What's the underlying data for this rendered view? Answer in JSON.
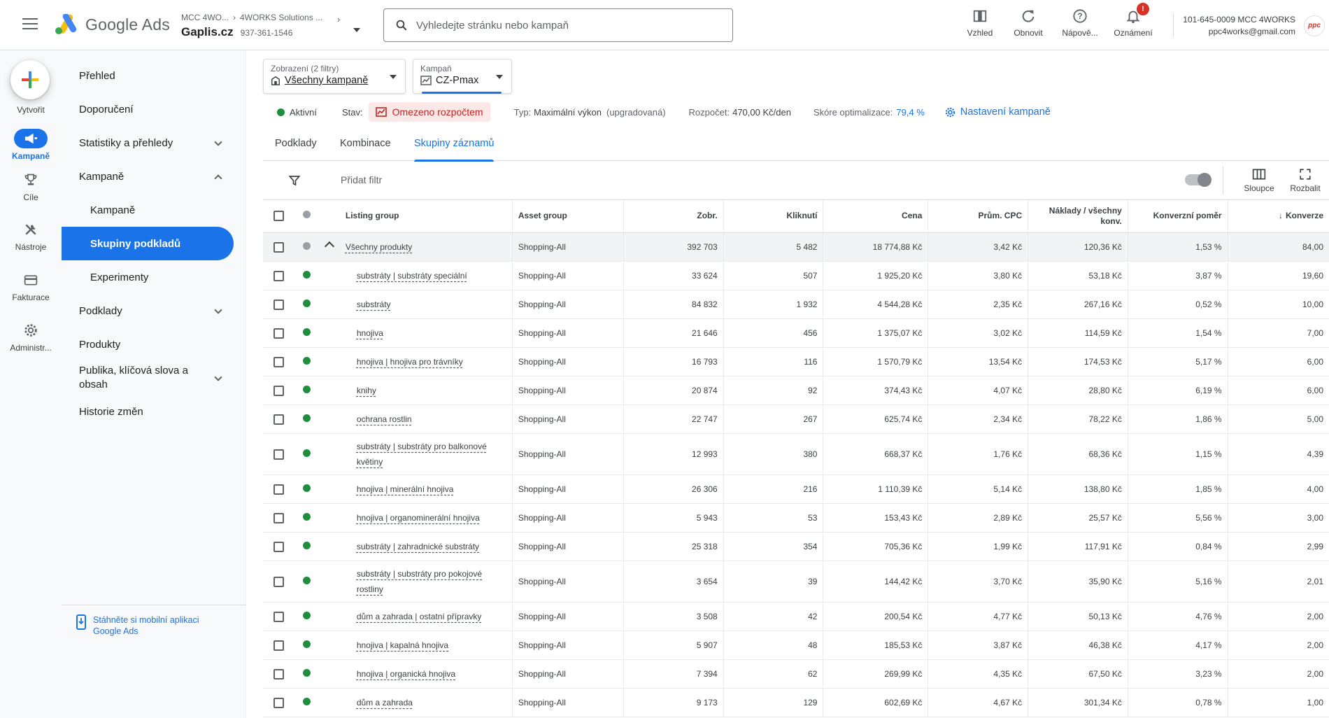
{
  "header": {
    "app_name": "Google Ads",
    "breadcrumb_manager": "MCC 4WO...",
    "breadcrumb_client": "4WORKS Solutions ...",
    "account_name": "Gaplis.cz",
    "account_id": "937-361-1546",
    "search_placeholder": "Vyhledejte stránku nebo kampaň",
    "actions": [
      {
        "label": "Vzhled",
        "icon": "appearance-icon"
      },
      {
        "label": "Obnovit",
        "icon": "refresh-icon"
      },
      {
        "label": "Nápově...",
        "icon": "help-icon"
      },
      {
        "label": "Oznámení",
        "icon": "notifications-icon",
        "badge": "!"
      }
    ],
    "user_line1": "101-645-0009 MCC 4WORKS",
    "user_line2": "ppc4works@gmail.com",
    "avatar_text": "ppc"
  },
  "rail": {
    "create_label": "Vytvořit",
    "items": [
      {
        "label": "Kampaně",
        "icon": "campaigns-icon",
        "active": true
      },
      {
        "label": "Cíle",
        "icon": "goals-icon"
      },
      {
        "label": "Nástroje",
        "icon": "tools-icon"
      },
      {
        "label": "Fakturace",
        "icon": "billing-icon"
      },
      {
        "label": "Administr...",
        "icon": "admin-icon"
      }
    ]
  },
  "nav": {
    "items": [
      {
        "label": "Přehled"
      },
      {
        "label": "Doporučení"
      },
      {
        "label": "Statistiky a přehledy",
        "chevron": "down"
      },
      {
        "label": "Kampaně",
        "chevron": "up"
      },
      {
        "label": "Kampaně",
        "sub": true
      },
      {
        "label": "Skupiny podkladů",
        "sub": true,
        "active": true
      },
      {
        "label": "Experimenty",
        "sub": true
      },
      {
        "label": "Podklady",
        "chevron": "down"
      },
      {
        "label": "Produkty"
      },
      {
        "label": "Publika, klíčová slova a obsah",
        "chevron": "down"
      },
      {
        "label": "Historie změn"
      }
    ],
    "footer_line1": "Stáhněte si mobilní aplikaci",
    "footer_line2": "Google Ads"
  },
  "filters": {
    "view_caption": "Zobrazení (2 filtry)",
    "view_value": "Všechny kampaně",
    "campaign_caption": "Kampaň",
    "campaign_value": "CZ-Pmax"
  },
  "status": {
    "state": "Aktivní",
    "status_label": "Stav:",
    "status_value": "Omezeno rozpočtem",
    "type_label": "Typ:",
    "type_value": "Maximální výkon",
    "type_note": "(upgradovaná)",
    "budget_label": "Rozpočet:",
    "budget_value": "470,00 Kč/den",
    "score_label": "Skóre optimalizace:",
    "score_value": "79,4 %",
    "settings_label": "Nastavení kampaně"
  },
  "tabs": [
    {
      "label": "Podklady"
    },
    {
      "label": "Kombinace"
    },
    {
      "label": "Skupiny záznamů",
      "active": true
    }
  ],
  "toolbar": {
    "add_filter": "Přidat filtr",
    "columns_label": "Sloupce",
    "expand_label": "Rozbalit"
  },
  "table": {
    "columns": [
      "Listing group",
      "Asset group",
      "Zobr.",
      "Kliknutí",
      "Cena",
      "Prům. CPC",
      "Náklady / všechny konv.",
      "Konverzní poměr",
      "Konverze"
    ],
    "sorted_column": "Konverze",
    "rows": [
      {
        "group": "Všechny produkty",
        "asset": "Shopping-All",
        "impr": "392 703",
        "clicks": "5 482",
        "cost": "18 774,88 Kč",
        "cpc": "3,42 Kč",
        "cpa": "120,36 Kč",
        "rate": "1,53 %",
        "conv": "84,00",
        "total": true
      },
      {
        "group": "substráty | substráty speciální",
        "asset": "Shopping-All",
        "impr": "33 624",
        "clicks": "507",
        "cost": "1 925,20 Kč",
        "cpc": "3,80 Kč",
        "cpa": "53,18 Kč",
        "rate": "3,87 %",
        "conv": "19,60"
      },
      {
        "group": "substráty",
        "asset": "Shopping-All",
        "impr": "84 832",
        "clicks": "1 932",
        "cost": "4 544,28 Kč",
        "cpc": "2,35 Kč",
        "cpa": "267,16 Kč",
        "rate": "0,52 %",
        "conv": "10,00"
      },
      {
        "group": "hnojiva",
        "asset": "Shopping-All",
        "impr": "21 646",
        "clicks": "456",
        "cost": "1 375,07 Kč",
        "cpc": "3,02 Kč",
        "cpa": "114,59 Kč",
        "rate": "1,54 %",
        "conv": "7,00"
      },
      {
        "group": "hnojiva | hnojiva pro trávníky",
        "asset": "Shopping-All",
        "impr": "16 793",
        "clicks": "116",
        "cost": "1 570,79 Kč",
        "cpc": "13,54 Kč",
        "cpa": "174,53 Kč",
        "rate": "5,17 %",
        "conv": "6,00"
      },
      {
        "group": "knihy",
        "asset": "Shopping-All",
        "impr": "20 874",
        "clicks": "92",
        "cost": "374,43 Kč",
        "cpc": "4,07 Kč",
        "cpa": "28,80 Kč",
        "rate": "6,19 %",
        "conv": "6,00"
      },
      {
        "group": "ochrana rostlin",
        "asset": "Shopping-All",
        "impr": "22 747",
        "clicks": "267",
        "cost": "625,74 Kč",
        "cpc": "2,34 Kč",
        "cpa": "78,22 Kč",
        "rate": "1,86 %",
        "conv": "5,00"
      },
      {
        "group": "substráty | substráty pro balkonové květiny",
        "asset": "Shopping-All",
        "impr": "12 993",
        "clicks": "380",
        "cost": "668,37 Kč",
        "cpc": "1,76 Kč",
        "cpa": "68,36 Kč",
        "rate": "1,15 %",
        "conv": "4,39",
        "tall": true
      },
      {
        "group": "hnojiva | minerální hnojiva",
        "asset": "Shopping-All",
        "impr": "26 306",
        "clicks": "216",
        "cost": "1 110,39 Kč",
        "cpc": "5,14 Kč",
        "cpa": "138,80 Kč",
        "rate": "1,85 %",
        "conv": "4,00"
      },
      {
        "group": "hnojiva | organominerální hnojiva",
        "asset": "Shopping-All",
        "impr": "5 943",
        "clicks": "53",
        "cost": "153,43 Kč",
        "cpc": "2,89 Kč",
        "cpa": "25,57 Kč",
        "rate": "5,56 %",
        "conv": "3,00"
      },
      {
        "group": "substráty | zahradnické substráty",
        "asset": "Shopping-All",
        "impr": "25 318",
        "clicks": "354",
        "cost": "705,36 Kč",
        "cpc": "1,99 Kč",
        "cpa": "117,91 Kč",
        "rate": "0,84 %",
        "conv": "2,99"
      },
      {
        "group": "substráty | substráty pro pokojové rostliny",
        "asset": "Shopping-All",
        "impr": "3 654",
        "clicks": "39",
        "cost": "144,42 Kč",
        "cpc": "3,70 Kč",
        "cpa": "35,90 Kč",
        "rate": "5,16 %",
        "conv": "2,01",
        "tall": true
      },
      {
        "group": "dům a zahrada | ostatní přípravky",
        "asset": "Shopping-All",
        "impr": "3 508",
        "clicks": "42",
        "cost": "200,54 Kč",
        "cpc": "4,77 Kč",
        "cpa": "50,13 Kč",
        "rate": "4,76 %",
        "conv": "2,00"
      },
      {
        "group": "hnojiva | kapalná hnojiva",
        "asset": "Shopping-All",
        "impr": "5 907",
        "clicks": "48",
        "cost": "185,53 Kč",
        "cpc": "3,87 Kč",
        "cpa": "46,38 Kč",
        "rate": "4,17 %",
        "conv": "2,00"
      },
      {
        "group": "hnojiva | organická hnojiva",
        "asset": "Shopping-All",
        "impr": "7 394",
        "clicks": "62",
        "cost": "269,99 Kč",
        "cpc": "4,35 Kč",
        "cpa": "67,50 Kč",
        "rate": "3,23 %",
        "conv": "2,00"
      },
      {
        "group": "dům a zahrada",
        "asset": "Shopping-All",
        "impr": "9 173",
        "clicks": "129",
        "cost": "602,69 Kč",
        "cpc": "4,67 Kč",
        "cpa": "301,34 Kč",
        "rate": "0,78 %",
        "conv": "1,00"
      }
    ]
  },
  "colors": {
    "accent": "#1a73e8",
    "active_status": "#1e8e3e",
    "limited_text": "#c5221f",
    "limited_bg": "#fce8e6"
  }
}
